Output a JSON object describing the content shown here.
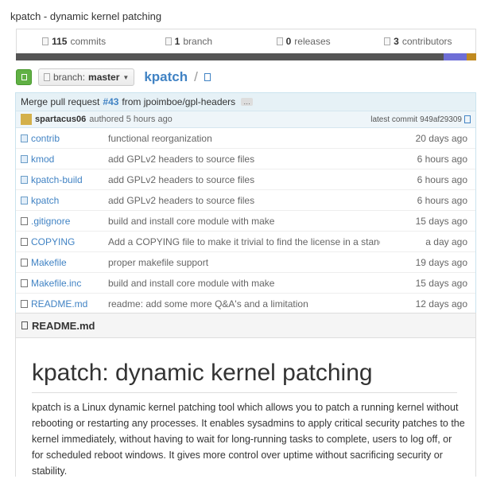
{
  "repo": {
    "description": "kpatch - dynamic kernel patching",
    "name": "kpatch",
    "slash": "/"
  },
  "stats": {
    "commits_count": "115",
    "commits_label": "commits",
    "branch_count": "1",
    "branch_label": "branch",
    "releases_count": "0",
    "releases_label": "releases",
    "contributors_count": "3",
    "contributors_label": "contributors"
  },
  "language_bar_colors": [
    "#555555",
    "#6e6ed6",
    "#c08a20"
  ],
  "toolbar": {
    "branch_prefix": "branch:",
    "branch_name": "master"
  },
  "latest_commit": {
    "message_prefix": "Merge pull request",
    "pr_number": "#43",
    "message_suffix": "from jpoimboe/gpl-headers",
    "ellipsis": "…",
    "author": "spartacus06",
    "authored_text": "authored 5 hours ago",
    "latest_label": "latest commit",
    "sha": "949af29309"
  },
  "files": [
    {
      "name": "contrib",
      "type": "dir",
      "message": "functional reorganization",
      "age": "20 days ago"
    },
    {
      "name": "kmod",
      "type": "dir",
      "message": "add GPLv2 headers to source files",
      "age": "6 hours ago"
    },
    {
      "name": "kpatch-build",
      "type": "dir",
      "message": "add GPLv2 headers to source files",
      "age": "6 hours ago"
    },
    {
      "name": "kpatch",
      "type": "dir",
      "message": "add GPLv2 headers to source files",
      "age": "6 hours ago"
    },
    {
      "name": ".gitignore",
      "type": "file",
      "message": "build and install core module with make",
      "age": "15 days ago"
    },
    {
      "name": "COPYING",
      "type": "file",
      "message": "Add a COPYING file to make it trivial to find the license in a standa...",
      "age": "a day ago"
    },
    {
      "name": "Makefile",
      "type": "file",
      "message": "proper makefile support",
      "age": "19 days ago"
    },
    {
      "name": "Makefile.inc",
      "type": "file",
      "message": "build and install core module with make",
      "age": "15 days ago"
    },
    {
      "name": "README.md",
      "type": "file",
      "message": "readme: add some more Q&A's and a limitation",
      "age": "12 days ago"
    }
  ],
  "readme": {
    "filename": "README.md",
    "heading": "kpatch: dynamic kernel patching",
    "paragraph": "kpatch is a Linux dynamic kernel patching tool which allows you to patch a running kernel without rebooting or restarting any processes. It enables sysadmins to apply critical security patches to the kernel immediately, without having to wait for long-running tasks to complete, users to log off, or for scheduled reboot windows. It gives more control over uptime without sacrificing security or stability."
  }
}
